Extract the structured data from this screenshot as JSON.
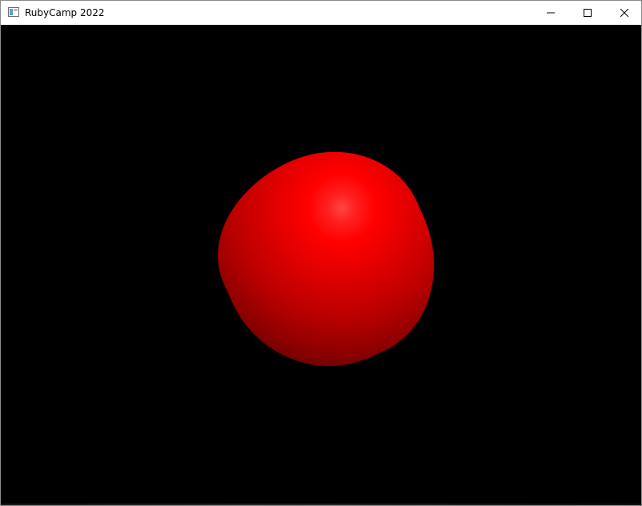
{
  "window": {
    "title": "RubyCamp 2022",
    "app_icon": "app-window-icon",
    "controls": {
      "minimize_icon": "minimize-icon",
      "maximize_icon": "maximize-icon",
      "close_icon": "close-icon"
    }
  },
  "scene": {
    "background_color": "#000000",
    "object": "red-sphere",
    "object_color": "#ff0000",
    "highlight_color": "#ff4545"
  }
}
